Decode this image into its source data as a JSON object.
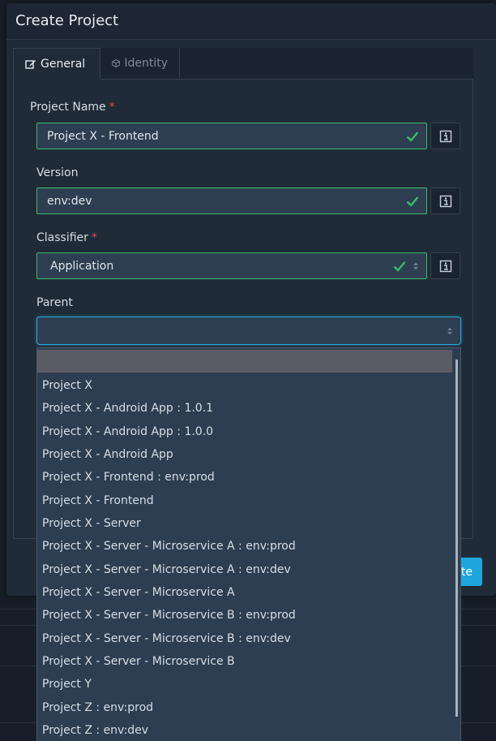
{
  "modal": {
    "title": "Create Project"
  },
  "tabs": [
    {
      "label": "General",
      "icon": "edit-icon",
      "active": true
    },
    {
      "label": "Identity",
      "icon": "cube-icon",
      "active": false
    }
  ],
  "fields": {
    "project_name": {
      "label": "Project Name",
      "required": "*",
      "value": "Project X - Frontend"
    },
    "version": {
      "label": "Version",
      "value": "env:dev"
    },
    "classifier": {
      "label": "Classifier",
      "required": "*",
      "value": "Application"
    },
    "parent": {
      "label": "Parent",
      "value": ""
    }
  },
  "footer": {
    "submit_label_visible": "te"
  },
  "parent_options": [
    "",
    "Project X",
    "Project X - Android App : 1.0.1",
    "Project X - Android App : 1.0.0",
    "Project X - Android App",
    "Project X - Frontend : env:prod",
    "Project X - Frontend",
    "Project X - Server",
    "Project X - Server - Microservice A : env:prod",
    "Project X - Server - Microservice A : env:dev",
    "Project X - Server - Microservice A",
    "Project X - Server - Microservice B : env:prod",
    "Project X - Server - Microservice B : env:dev",
    "Project X - Server - Microservice B",
    "Project Y",
    "Project Z : env:prod",
    "Project Z : env:dev"
  ],
  "colors": {
    "valid_border": "#3cba6b",
    "focus_border": "#2ba9e0",
    "required": "#e04b4b",
    "primary": "#1fa7db"
  }
}
